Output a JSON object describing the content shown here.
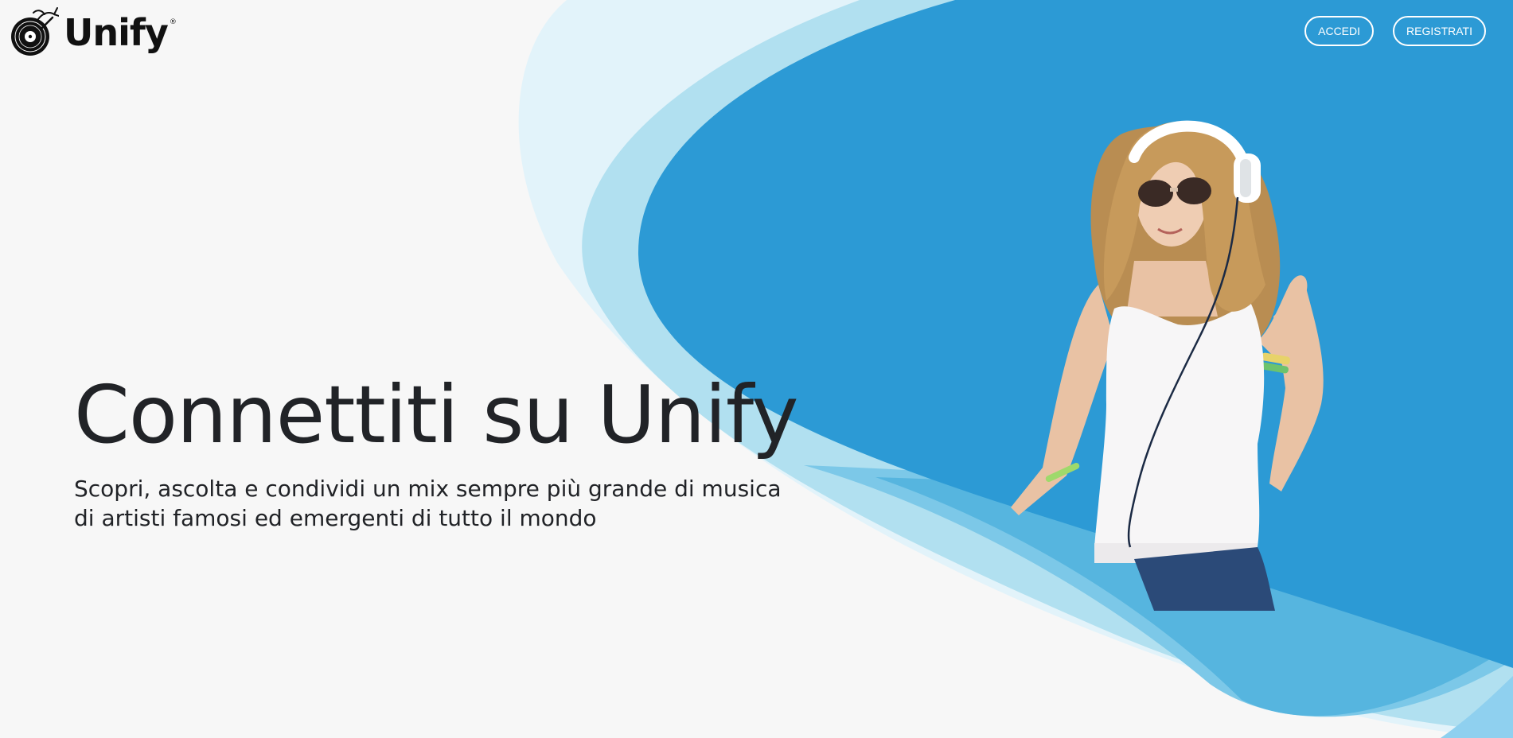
{
  "brand": {
    "name": "Unify",
    "registered_mark": "®"
  },
  "nav": {
    "login_label": "ACCEDI",
    "register_label": "REGISTRATI"
  },
  "hero": {
    "title": "Connettiti su Unify",
    "subtitle": "Scopri, ascolta e condividi un mix sempre più grande di musica di artisti famosi ed emergenti di tutto il mondo"
  },
  "icons": {
    "logo": "vinyl-record-logo-icon"
  },
  "colors": {
    "background": "#f7f7f7",
    "primary_blue": "#2c9ad5",
    "light_blue": "#b1e0f0",
    "pale_blue": "#e2f3fa",
    "mid_blue": "#7cc8e8",
    "text_dark": "#212327"
  }
}
